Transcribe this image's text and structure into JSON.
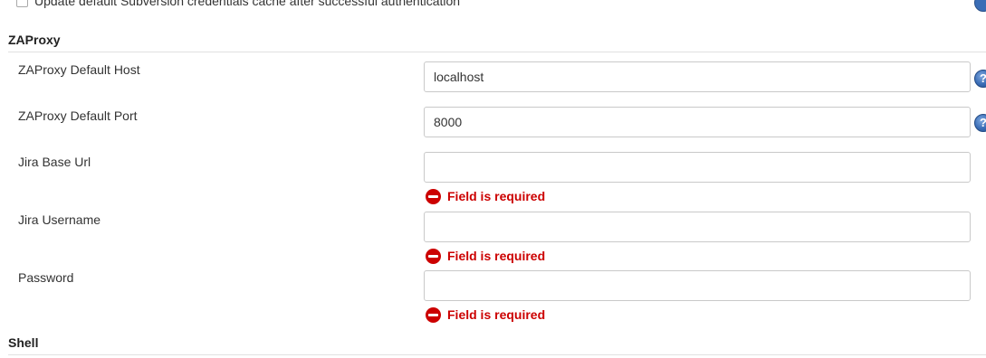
{
  "top_row": {
    "label": "Update default Subversion credentials cache after successful authentication"
  },
  "sections": {
    "zaproxy": {
      "title": "ZAProxy"
    },
    "shell": {
      "title": "Shell"
    }
  },
  "fields": {
    "default_host": {
      "label": "ZAProxy Default Host",
      "value": "localhost"
    },
    "default_port": {
      "label": "ZAProxy Default Port",
      "value": "8000"
    },
    "jira_base_url": {
      "label": "Jira Base Url",
      "value": ""
    },
    "jira_username": {
      "label": "Jira Username",
      "value": ""
    },
    "password": {
      "label": "Password",
      "value": ""
    }
  },
  "validation": {
    "required_message": "Field is required"
  },
  "icons": {
    "help": "help-icon",
    "error": "error-icon"
  },
  "colors": {
    "error": "#cc0000",
    "help_blue": "#3a6db6",
    "field_border": "#c9c9c9"
  }
}
